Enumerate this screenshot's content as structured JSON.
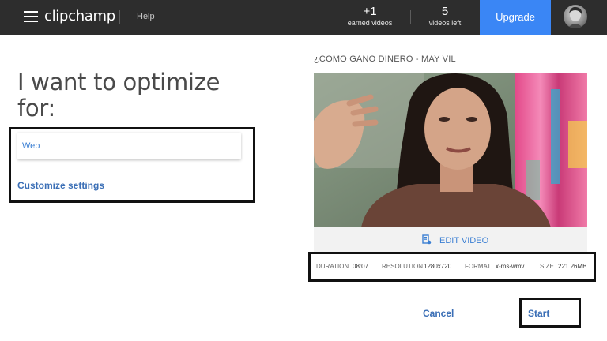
{
  "header": {
    "logo": "clipchamp",
    "help_label": "Help",
    "earned": {
      "value": "+1",
      "label": "earned videos"
    },
    "left": {
      "value": "5",
      "label": "videos left"
    },
    "upgrade_label": "Upgrade"
  },
  "optimize": {
    "heading": "I want to optimize for:",
    "selected_value": "Web",
    "customize_label": "Customize settings"
  },
  "video": {
    "title": "¿COMO GANO DINERO - MAY VIL",
    "edit_label": "EDIT VIDEO",
    "meta": {
      "duration_label": "DURATION",
      "duration_value": "08:07",
      "resolution_label": "RESOLUTION",
      "resolution_value": "1280x720",
      "format_label": "FORMAT",
      "format_value": "x-ms-wmv",
      "size_label": "SIZE",
      "size_value": "221.26MB"
    }
  },
  "actions": {
    "cancel_label": "Cancel",
    "start_label": "Start"
  },
  "colors": {
    "topbar": "#2d2d2d",
    "accent": "#3a86f5",
    "link": "#3b6fb6"
  },
  "icons": [
    "menu-icon",
    "avatar",
    "edit-video-icon"
  ]
}
